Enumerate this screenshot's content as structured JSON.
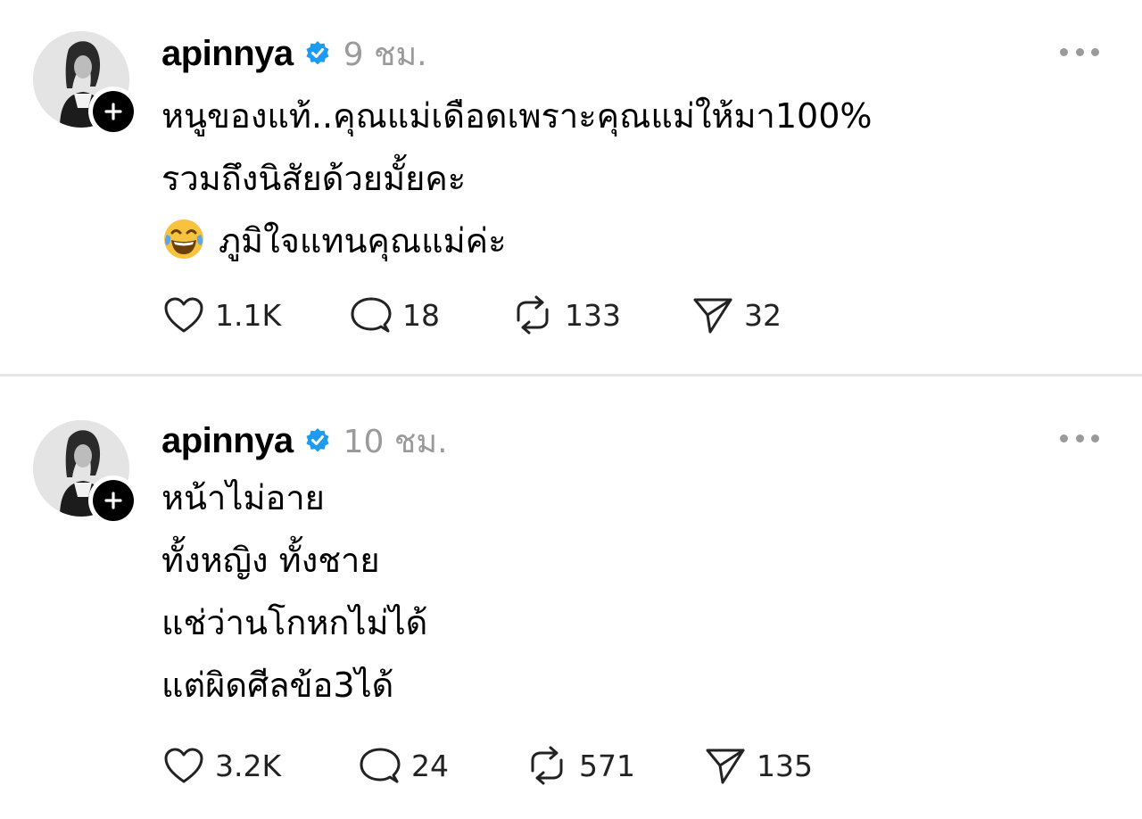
{
  "posts": [
    {
      "username": "apinnya",
      "verified_icon": "verified-badge-icon",
      "timestamp": "9 ชม.",
      "text_lines": [
        "หนูของแท้..คุณแม่เดือดเพราะคุณแม่ให้มา100%",
        "รวมถึงนิสัยด้วยมั้ยคะ",
        "ภูมิใจแทนคุณแม่ค่ะ"
      ],
      "emoji": "face-with-tears-of-joy",
      "likes": "1.1K",
      "replies": "18",
      "reposts": "133",
      "shares": "32"
    },
    {
      "username": "apinnya",
      "verified_icon": "verified-badge-icon",
      "timestamp": "10 ชม.",
      "text_lines": [
        "หน้าไม่อาย",
        "ทั้งหญิง ทั้งชาย",
        "แช่ว่านโกหกไม่ได้",
        "แต่ผิดศีลข้อ3ได้"
      ],
      "likes": "3.2K",
      "replies": "24",
      "reposts": "571",
      "shares": "135"
    }
  ],
  "colors": {
    "verified": "#1d9bf0",
    "timestamp": "#9a9a9a",
    "divider": "#e6e6e6"
  }
}
